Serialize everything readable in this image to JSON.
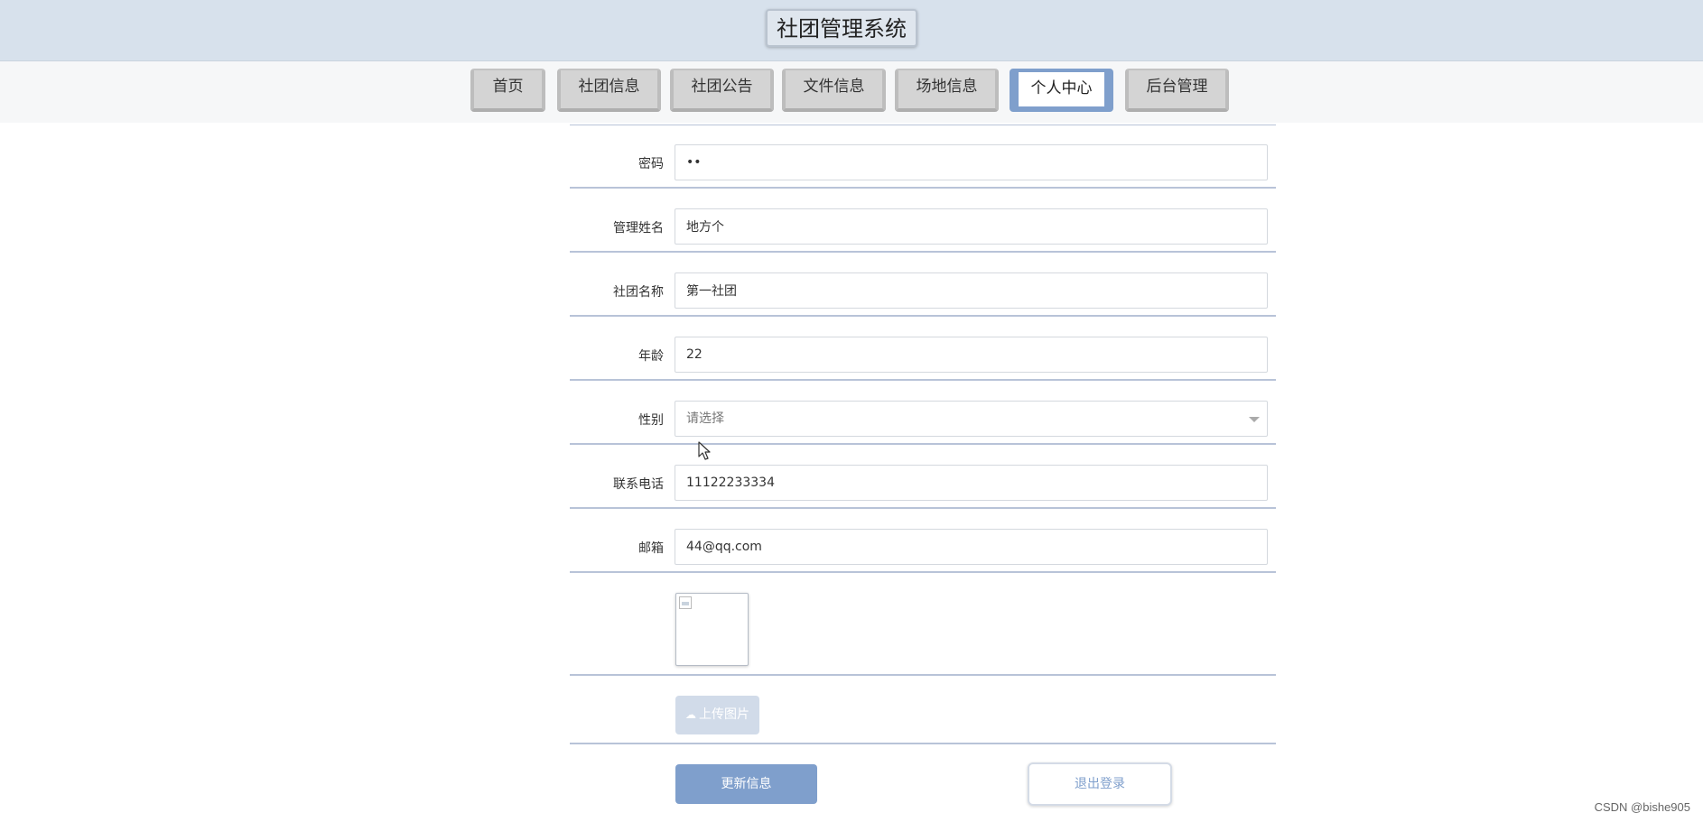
{
  "header": {
    "title": "社团管理系统"
  },
  "nav": {
    "items": [
      {
        "label": "首页"
      },
      {
        "label": "社团信息"
      },
      {
        "label": "社团公告"
      },
      {
        "label": "文件信息"
      },
      {
        "label": "场地信息"
      },
      {
        "label": "个人中心",
        "active": true
      },
      {
        "label": "后台管理"
      }
    ]
  },
  "form": {
    "password": {
      "label": "密码",
      "value": "••"
    },
    "name": {
      "label": "管理姓名",
      "value": "地方个"
    },
    "club": {
      "label": "社团名称",
      "value": "第一社团"
    },
    "age": {
      "label": "年龄",
      "value": "22"
    },
    "gender": {
      "label": "性别",
      "value": "请选择"
    },
    "phone": {
      "label": "联系电话",
      "value": "11122233334"
    },
    "email": {
      "label": "邮箱",
      "value": "44@qq.com"
    },
    "upload_label": "上传图片"
  },
  "actions": {
    "update": "更新信息",
    "logout": "退出登录"
  },
  "watermark": "CSDN @bishe905",
  "colors": {
    "header_bg": "#d7e1ec",
    "accent": "#7f9fcc",
    "nav_inactive": "#d4d4d4",
    "upload_btn": "#d1dbe9"
  }
}
